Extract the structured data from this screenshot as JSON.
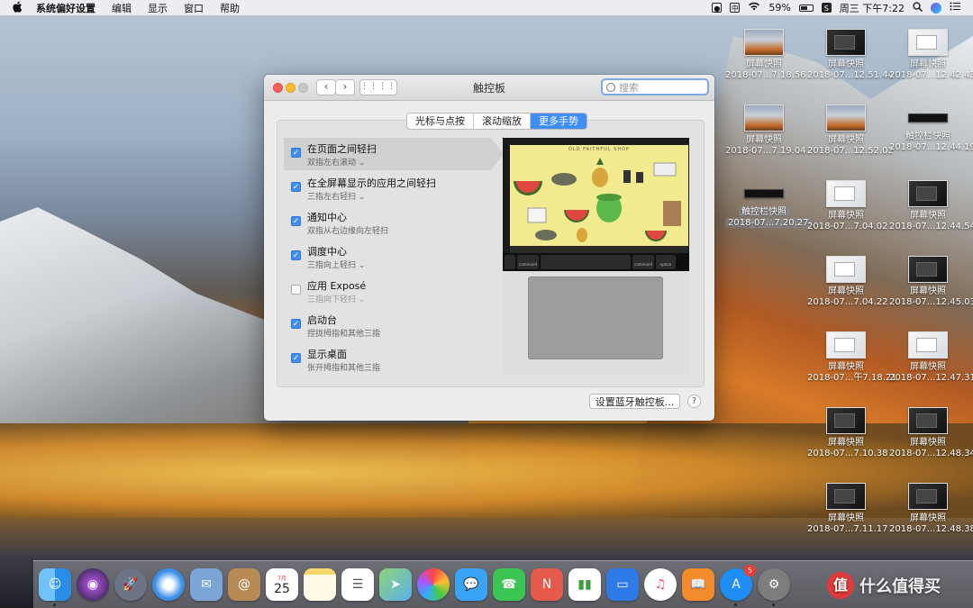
{
  "menubar": {
    "apple_icon": "apple-logo-icon",
    "app_name": "系统偏好设置",
    "items": [
      "编辑",
      "显示",
      "窗口",
      "帮助"
    ],
    "status": {
      "battery_percent": "59%",
      "datetime": "周三 下午7:22",
      "input_badge": "中",
      "sogou": "S"
    }
  },
  "desktop": {
    "items": [
      {
        "label1": "屏幕快照",
        "label2": "2018-07...7.18.56"
      },
      {
        "label1": "屏幕快照",
        "label2": "2018-07...12.51.44"
      },
      {
        "label1": "屏幕快照",
        "label2": "2018-07...12.42.43"
      },
      {
        "label1": "屏幕快照",
        "label2": "2018-07...7.19.04"
      },
      {
        "label1": "屏幕快照",
        "label2": "2018-07...12.52.02"
      },
      {
        "label1": "触控栏快照",
        "label2": "2018-07...12.44.19"
      },
      {
        "label1": "触控栏快照",
        "label2": "2018-07...7.20.27"
      },
      {
        "label1": "屏幕快照",
        "label2": "2018-07...7.04.02"
      },
      {
        "label1": "屏幕快照",
        "label2": "2018-07...12.44.54"
      },
      {
        "label1": "屏幕快照",
        "label2": "2018-07...7.04.22"
      },
      {
        "label1": "屏幕快照",
        "label2": "2018-07...12.45.03"
      },
      {
        "label1": "屏幕快照",
        "label2": "2018-07...午7.18.21"
      },
      {
        "label1": "屏幕快照",
        "label2": "2018-07...12.47.31"
      },
      {
        "label1": "屏幕快照",
        "label2": "2018-07...7.10.38"
      },
      {
        "label1": "屏幕快照",
        "label2": "2018-07...12.48.34"
      },
      {
        "label1": "屏幕快照",
        "label2": "2018-07...7.11.17"
      },
      {
        "label1": "屏幕快照",
        "label2": "2018-07...12.48.38"
      }
    ]
  },
  "window": {
    "title": "触控板",
    "search_placeholder": "搜索",
    "tabs": [
      "光标与点按",
      "滚动缩放",
      "更多手势"
    ],
    "active_tab": 2,
    "options": [
      {
        "title": "在页面之间轻扫",
        "sub": "双指左右滚动 ⌄",
        "checked": true
      },
      {
        "title": "在全屏幕显示的应用之间轻扫",
        "sub": "三指左右轻扫 ⌄",
        "checked": true
      },
      {
        "title": "通知中心",
        "sub": "双指从右边缘向左轻扫",
        "checked": true
      },
      {
        "title": "调度中心",
        "sub": "三指向上轻扫 ⌄",
        "checked": true
      },
      {
        "title": "应用 Exposé",
        "sub": "三指向下轻扫 ⌄",
        "checked": false
      },
      {
        "title": "启动台",
        "sub": "捏拢拇指和其他三指",
        "checked": true
      },
      {
        "title": "显示桌面",
        "sub": "张开拇指和其他三指",
        "checked": true
      }
    ],
    "preview": {
      "shop_title": "OLD FAITHFUL SHOP",
      "touchbar_keys": [
        "command",
        "command",
        "option"
      ]
    },
    "bluetooth_button": "设置蓝牙触控板...",
    "help_button": "?"
  },
  "dock": {
    "app_store_badge": "5",
    "calendar_month": "7月",
    "calendar_day": "25"
  },
  "watermark": {
    "text": "什么值得买",
    "logo": "值"
  }
}
